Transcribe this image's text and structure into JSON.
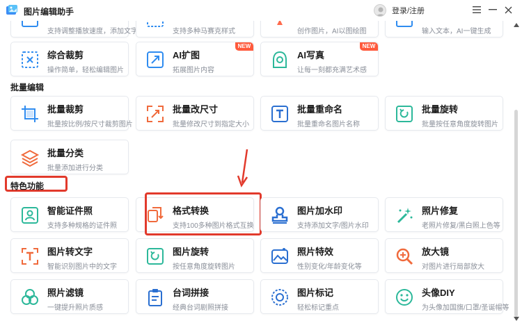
{
  "app": {
    "title": "图片编辑助手",
    "login_label": "登录/注册"
  },
  "icons": {
    "menu": "hamburger-icon",
    "minimize": "minimize-icon",
    "close": "close-icon",
    "scroll_up": "triangle-up-icon",
    "scroll_down": "triangle-down-icon"
  },
  "top_row": {
    "c1_desc": "支持调整播放速度，添加文字",
    "c2_desc": "支持多种马赛克样式",
    "c3_desc": "创作图片，AI以图绘图",
    "c4_desc": "输入文本，AI一键生成"
  },
  "row_ai": {
    "c1_title": "综合裁剪",
    "c1_desc": "操作简单，轻松编辑图片",
    "c2_title": "AI扩图",
    "c2_desc": "拓展图片内容",
    "c2_badge": "NEW",
    "c3_title": "AI写真",
    "c3_desc": "让每一刻都充满艺术感",
    "c3_badge": "NEW"
  },
  "batch": {
    "heading": "批量编辑",
    "c1_title": "批量裁剪",
    "c1_desc": "批量按比例/按尺寸裁剪图片",
    "c2_title": "批量改尺寸",
    "c2_desc": "批量修改尺寸到指定大小",
    "c3_title": "批量重命名",
    "c3_desc": "批量重命名图片名称",
    "c4_title": "批量旋转",
    "c4_desc": "批量按任意角度旋转图片",
    "c5_title": "批量分类",
    "c5_desc": "批量添加进行分类"
  },
  "special": {
    "heading": "特色功能",
    "r1c1_title": "智能证件照",
    "r1c1_desc": "支持多种规格的证件照",
    "r1c2_title": "格式转换",
    "r1c2_desc": "支持100多种图片格式互换",
    "r1c3_title": "图片加水印",
    "r1c3_desc": "支持添加文字/图片水印",
    "r1c4_title": "照片修复",
    "r1c4_desc": "老照片修复/黑白照上色等",
    "r2c1_title": "图片转文字",
    "r2c1_desc": "智能识别图片中的文字",
    "r2c2_title": "图片旋转",
    "r2c2_desc": "按任意角度旋转图片",
    "r2c3_title": "照片特效",
    "r2c3_desc": "性别变化/年龄变化等",
    "r2c4_title": "放大镜",
    "r2c4_desc": "对图片进行局部放大",
    "r3c1_title": "照片滤镜",
    "r3c1_desc": "一键提升照片质感",
    "r3c2_title": "台词拼接",
    "r3c2_desc": "经典台词剧照拼接",
    "r3c3_title": "图片标记",
    "r3c3_desc": "轻松标记重点",
    "r3c4_title": "头像DIY",
    "r3c4_desc": "为头像加国旗/口罩/圣诞帽等"
  },
  "colors": {
    "accent": "#2f8cf0",
    "highlight": "#e23a2c",
    "badge": "#ff5a3c"
  }
}
